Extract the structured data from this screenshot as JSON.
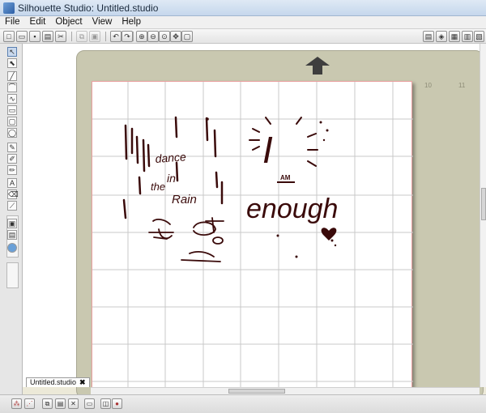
{
  "window": {
    "title": "Silhouette Studio: Untitled.studio"
  },
  "menu": [
    "File",
    "Edit",
    "Object",
    "View",
    "Help"
  ],
  "document": {
    "tab_label": "Untitled.studio",
    "tab_close": "✖"
  },
  "drawing": {
    "words_left": [
      "dance",
      "in",
      "the",
      "Rain"
    ],
    "words_right_top": "I",
    "words_right_mid": "AM",
    "words_right_bottom": "enough"
  },
  "icons": {
    "arrow_up": "load-arrow-icon",
    "close": "close-icon"
  },
  "colors": {
    "ink": "#3a0a0a",
    "mat": "#c9c8b0",
    "cut_border": "#e9a0a0",
    "grid": "#c8c8c8"
  }
}
